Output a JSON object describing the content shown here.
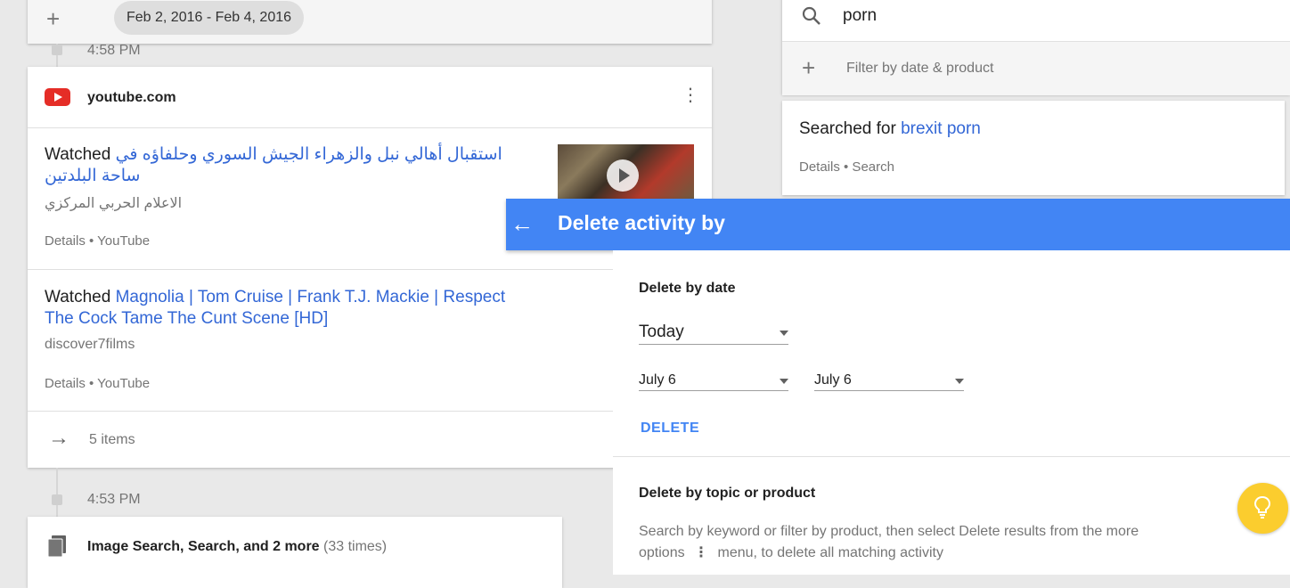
{
  "left": {
    "date_range": "Feb 2, 2016 - Feb 4, 2016",
    "time1": "4:58 PM",
    "card": {
      "site": "youtube.com",
      "items": [
        {
          "prefix": "Watched ",
          "title": "استقبال أهالي نبل والزهراء الجيش السوري وحلفاؤه في ساحة البلدتين",
          "channel": "الاعلام الحربي المركزي",
          "meta": "Details • YouTube"
        },
        {
          "prefix": "Watched ",
          "title": "Magnolia | Tom Cruise | Frank T.J. Mackie | Respect The Cock Tame The Cunt Scene [HD]",
          "channel": "discover7films",
          "meta": "Details • YouTube"
        }
      ],
      "more": "5 items"
    },
    "time2": "4:53 PM",
    "card2": {
      "title": "Image Search, Search, and 2 more",
      "count": "(33 times)"
    }
  },
  "right": {
    "search_query": "porn",
    "filter_label": "Filter by date & product",
    "result": {
      "prefix": "Searched for ",
      "query": "brexit porn",
      "meta": "Details • Search"
    }
  },
  "delete": {
    "title": "Delete activity by",
    "by_date_label": "Delete by date",
    "range_select": "Today",
    "from_date": "July 6",
    "to_date": "July 6",
    "delete_button": "DELETE",
    "by_topic_label": "Delete by topic or product",
    "help_part1": "Search by keyword or filter by product, then select Delete results from the more options",
    "help_part2": "menu, to delete all matching activity"
  },
  "colors": {
    "accent": "#4285f4",
    "link": "#3367d6",
    "youtube": "#e52d27",
    "bulb": "#fbcd2e"
  },
  "icons": [
    "plus-icon",
    "youtube-icon",
    "more-vert-icon",
    "arrow-right-icon",
    "doc-icon",
    "search-icon",
    "arrow-back-icon",
    "lightbulb-icon",
    "caret-down-icon"
  ]
}
